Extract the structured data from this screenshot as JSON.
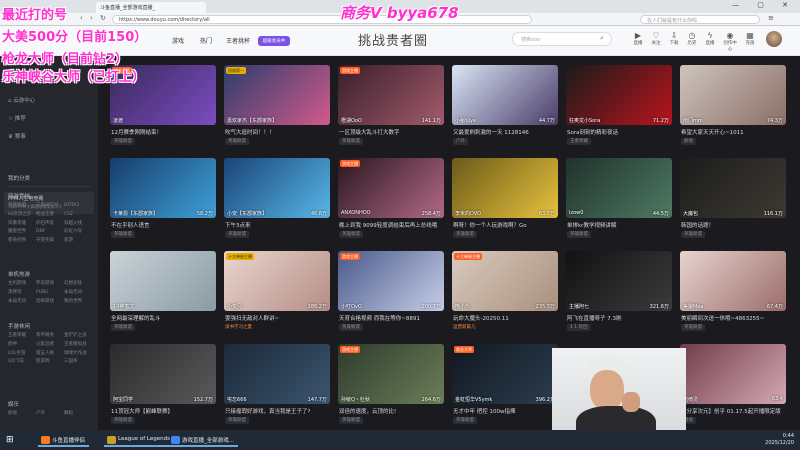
{
  "browser": {
    "tab1_title": "斗鱼直播_全部游戏直播_",
    "tab2_title": "",
    "url": "https://www.douyu.com/directory/all",
    "search_placeholder": "在人们就是有什么你吗",
    "window_controls": "— ▢ ✕"
  },
  "header": {
    "nav": [
      "游戏",
      "热门",
      "王者挑杯"
    ],
    "vip_badge": "超级会员中",
    "banner": "挑战贵者圈",
    "search_placeholder": "搜索ooo",
    "icons": [
      {
        "icon": "play-icon",
        "label": "直播"
      },
      {
        "icon": "heart-icon",
        "label": "关注"
      },
      {
        "icon": "download-icon",
        "label": "下载"
      },
      {
        "icon": "clock-icon",
        "label": "历史"
      },
      {
        "icon": "lightning-icon",
        "label": "直播"
      },
      {
        "icon": "bell-icon",
        "label": "创作中心"
      },
      {
        "icon": "grid-icon",
        "label": "充值"
      }
    ]
  },
  "overlay": {
    "lines": [
      "最近打的号",
      "大美500分（目前150）",
      "枪龙大师（目前钻2）",
      "乐神峡谷大师（已打上）"
    ],
    "top_right": "商务V byya678"
  },
  "sidebar": {
    "items": [
      {
        "icon": "home-icon",
        "label": "云游中心"
      },
      {
        "icon": "star-icon",
        "label": "推荐"
      },
      {
        "icon": "trophy-icon",
        "label": "赛事"
      }
    ],
    "active_title": "PPM人生电竞赛",
    "active_sub": "TEKI PPM大赛刚刚得奖前二大",
    "my_category": "我的分类",
    "sections": [
      {
        "title": "网游竞技",
        "games": [
          "英雄联盟",
          "三角洲行动",
          "DOTA2",
          "lol云顶之弈",
          "枪战王者",
          "CS2",
          "风暴英雄",
          "炉石传说",
          "穿越火线",
          "魔兽世界",
          "DNF",
          "彩虹六号",
          "使命召唤",
          "守望先锋",
          "新游"
        ]
      },
      {
        "title": "单机热游",
        "games": [
          "主机游戏",
          "怀旧游戏",
          "幻想竞技",
          "黑神话",
          "PUBG",
          "永劫无间",
          "永劫无间",
          "恐怖游戏",
          "我的世界"
        ]
      },
      {
        "title": "手游休闲",
        "games": [
          "王者荣耀",
          "和平精英",
          "金铲铲之战",
          "原神",
          "火影忍者",
          "王者模拟战",
          "LOL手游",
          "第五人格",
          "球球大作战",
          "QQ飞车",
          "新游戏",
          "三国杀"
        ]
      },
      {
        "title": "娱乐",
        "games": [
          "颜值",
          "户外",
          "舞蹈"
        ]
      }
    ]
  },
  "cards": [
    {
      "badge": "商业大师",
      "streamer": "凌渡",
      "viewers": "",
      "title": "12月赛季刚刚结束！",
      "tag": "英雄联盟"
    },
    {
      "badge": "国服第一",
      "streamer": "嘉欢家杰【东郡家族】",
      "viewers": "",
      "title": "吹气大逛时间！！！",
      "tag": "英雄联盟"
    },
    {
      "badge": "游戏主播",
      "streamer": "橙湖OoO",
      "viewers": "141.1万",
      "title": "一区顶级大乱斗打大数字",
      "tag": "英雄联盟"
    },
    {
      "badge": "",
      "streamer": "小秘仙ye",
      "viewers": "44.7万",
      "title": "又最爱刷刺激的一天 1128146",
      "tag": "户外"
    },
    {
      "badge": "",
      "streamer": "狂奥龙小Sora",
      "viewers": "71.2万",
      "title": "Sora刻刻的精彩夜话",
      "tag": "王者荣耀"
    },
    {
      "badge": "",
      "streamer": "南门mm",
      "viewers": "74.3万",
      "title": "希望大家天天开心~1011",
      "tag": "颜值"
    },
    {
      "badge": "",
      "streamer": "卡莱恩【东郡家族】",
      "viewers": "58.2万",
      "title": "不在乎别人语言",
      "tag": "英雄联盟"
    },
    {
      "badge": "",
      "streamer": "小安【东郡家族】",
      "viewers": "46.8万",
      "title": "下午3点来",
      "tag": "英雄联盟"
    },
    {
      "badge": "游戏主播",
      "streamer": "ANXONHOO",
      "viewers": "258.4万",
      "title": "晚上到我 9099轻度调结束后再上总线哦",
      "tag": "英雄联盟"
    },
    {
      "badge": "",
      "streamer": "李米的DVD",
      "viewers": "63.5万",
      "title": "啊呀！你一个人玩游戏啊？Go",
      "tag": "英雄联盟"
    },
    {
      "badge": "",
      "streamer": "Izow0",
      "viewers": "44.5万",
      "title": "单排kr教学视频讲解",
      "tag": "英雄联盟"
    },
    {
      "badge": "",
      "streamer": "大魔包",
      "viewers": "116.1万",
      "title": "韩国的话题！",
      "tag": "英雄联盟"
    },
    {
      "badge": "",
      "streamer": "14神笔文",
      "viewers": "",
      "title": "全网最深理解的乱斗",
      "tag": "英雄联盟"
    },
    {
      "badge": "十大神秘主播",
      "streamer": "小悦兄",
      "viewers": "286.2万",
      "title": "耍强扫无敌对人群讲~",
      "tag": "读书学习之夏"
    },
    {
      "badge": "游戏主播",
      "streamer": "小叮OvO",
      "viewers": "200.7万",
      "title": "天育合格视频 而我在等你~8891",
      "tag": "英雄联盟"
    },
    {
      "badge": "十大神秘主播",
      "streamer": "喵小乐",
      "viewers": "235.3万",
      "title": "玩命大魔头-20250.11",
      "tag": "运营新篇儿"
    },
    {
      "badge": "",
      "streamer": "主播阿七",
      "viewers": "321.6万",
      "title": "阿飞在直播呀子 7.3刷",
      "tag": "1 1 轮回"
    },
    {
      "badge": "",
      "streamer": "美娜Mea",
      "viewers": "67.4万",
      "title": "美丽瞬间次送一休哦~4863255~",
      "tag": "英雄联盟"
    },
    {
      "badge": "",
      "streamer": "阿宝同学",
      "viewers": "152.7万",
      "title": "11顶冠大师【巅峰联赛】",
      "tag": "英雄联盟"
    },
    {
      "badge": "",
      "streamer": "宅忘666",
      "viewers": "147.7万",
      "title": "只接瘤瑕好游戏，真当我是王子了?",
      "tag": "英雄联盟"
    },
    {
      "badge": "游戏主播",
      "streamer": "孙敏Q丶杜秋",
      "viewers": "264.6万",
      "title": "双倍的速度，云顶的比!",
      "tag": "英雄联盟"
    },
    {
      "badge": "商业大师",
      "streamer": "金虹恒华V5ymk",
      "viewers": "396.2万",
      "title": "无才中年 把控 100w指揮",
      "tag": "英雄联盟"
    },
    {
      "badge": "",
      "streamer": "",
      "viewers": "",
      "title": "",
      "tag": ""
    },
    {
      "badge": "",
      "streamer": "岩绮灵",
      "viewers": "63.4",
      "title": "【分享次元】创乎 01.17.5起开播限定版",
      "tag": "颜值"
    }
  ],
  "taskbar": {
    "items": [
      {
        "label": "斗鱼直播伴侣",
        "color": "#ff7a1a"
      },
      {
        "label": "League of Legends",
        "color": "#c9a227"
      },
      {
        "label": "游戏直播_全部游戏...",
        "color": "#4285f4"
      }
    ],
    "time": "0:44",
    "date": "2025/12/20"
  }
}
